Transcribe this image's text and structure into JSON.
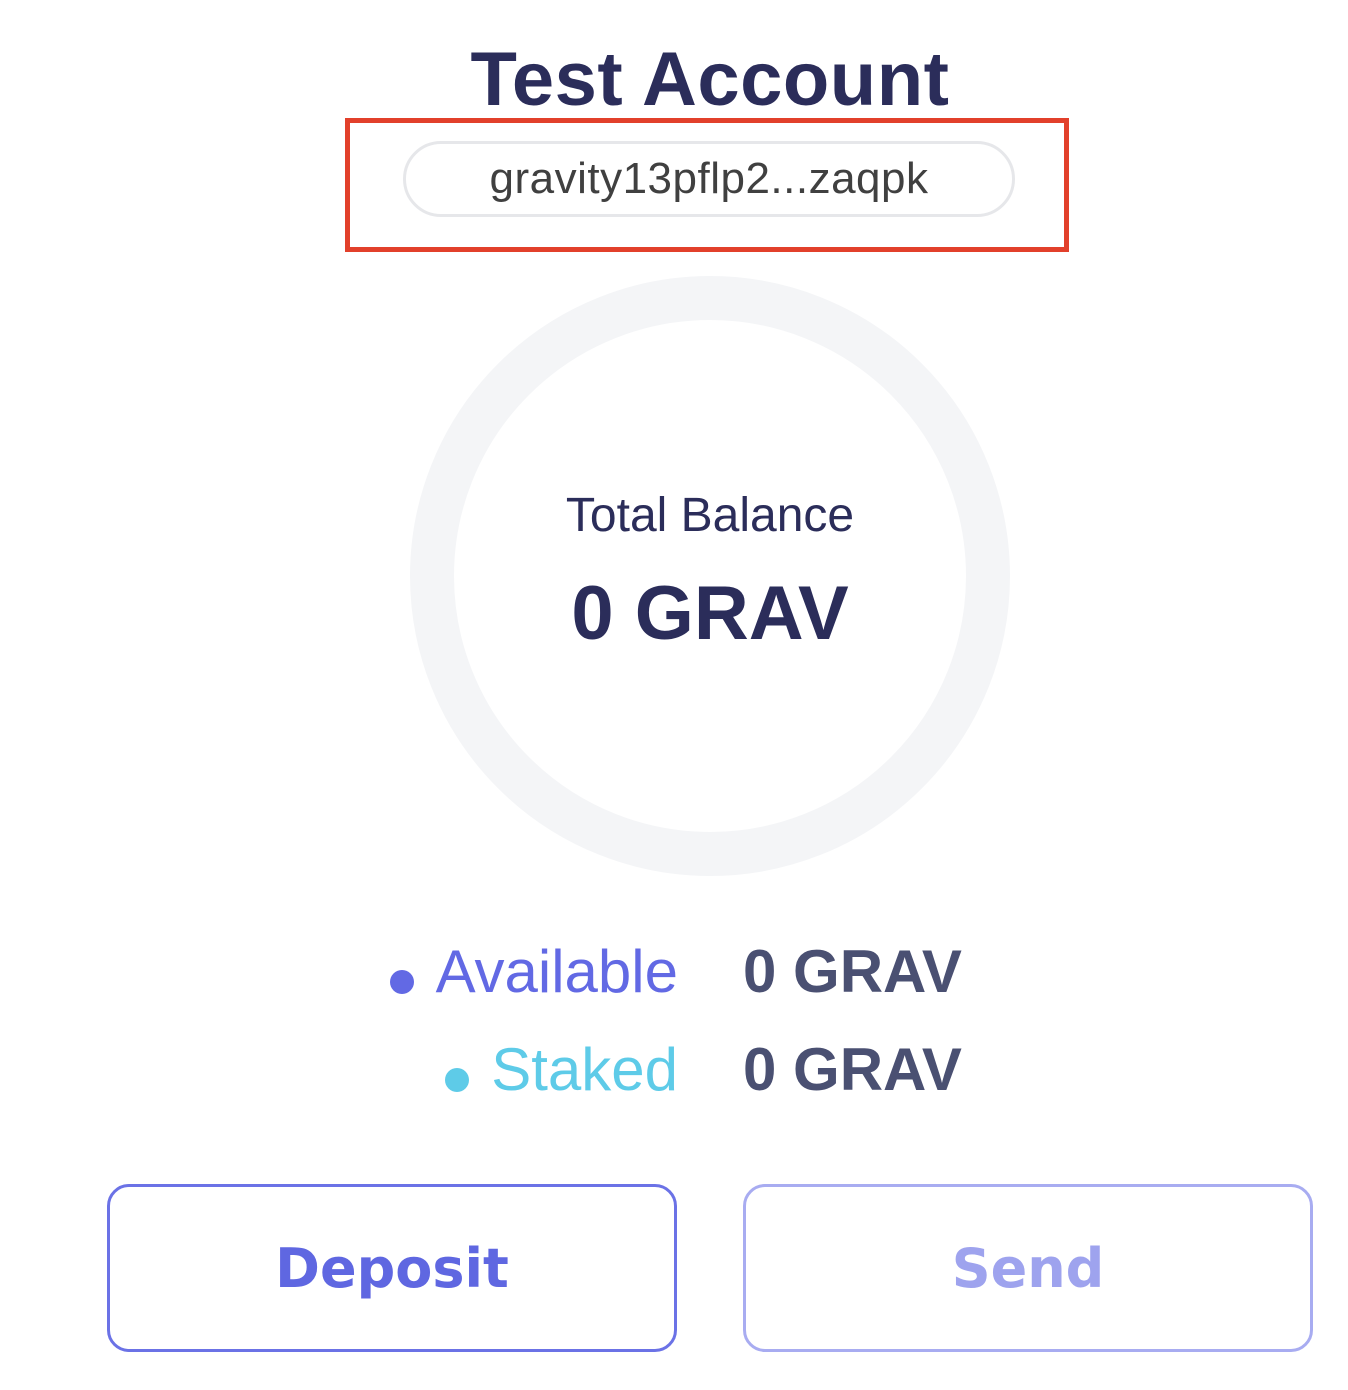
{
  "account": {
    "name": "Test Account",
    "address_short": "gravity13pflp2...zaqpk"
  },
  "balance": {
    "label": "Total Balance",
    "value": "0 GRAV"
  },
  "breakdown": [
    {
      "label": "Available",
      "value": "0 GRAV",
      "color": "#6269e4"
    },
    {
      "label": "Staked",
      "value": "0 GRAV",
      "color": "#5ecbe8"
    }
  ],
  "actions": {
    "deposit_label": "Deposit",
    "send_label": "Send"
  },
  "colors": {
    "primary_text": "#2b2d5a",
    "accent": "#5f67e1",
    "highlight": "#e2402b"
  }
}
